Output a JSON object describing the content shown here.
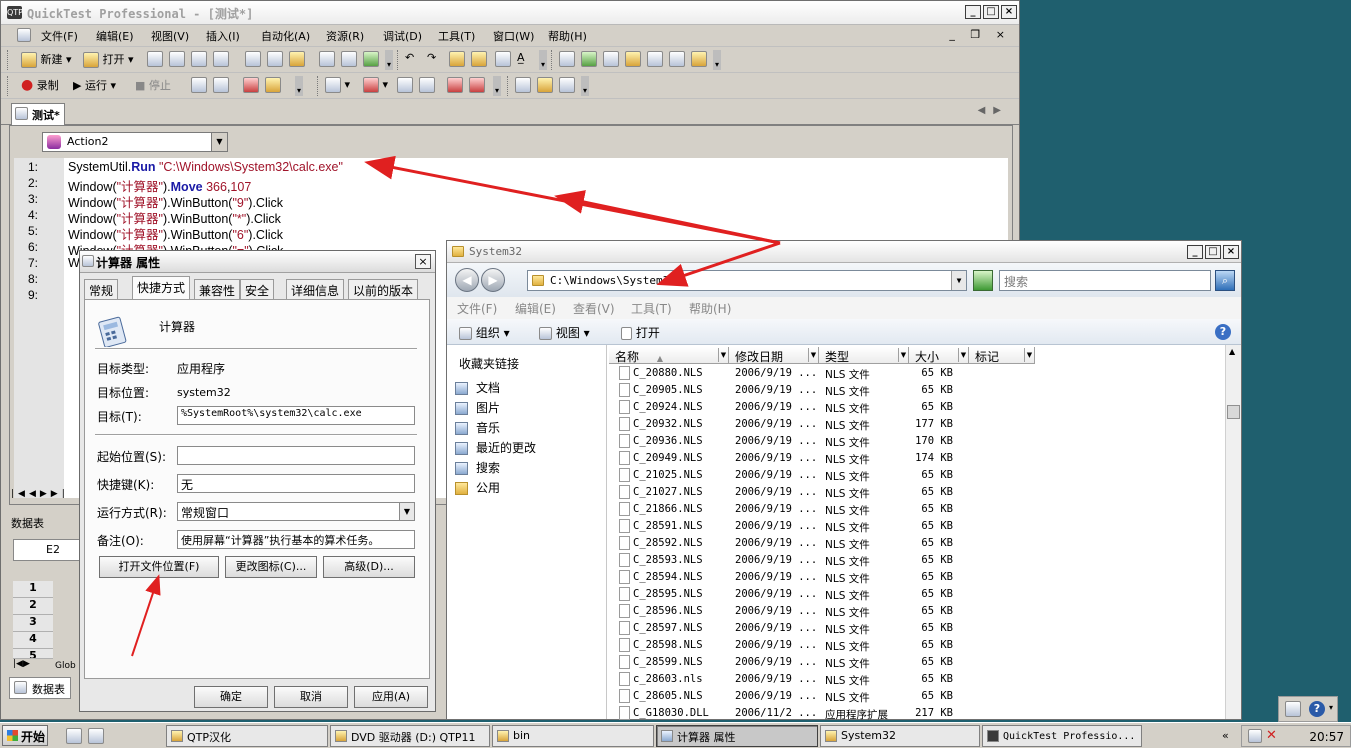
{
  "qtp": {
    "title": "QuickTest Professional - [测试*]",
    "app_icon": "QTP",
    "menu": [
      "文件(F)",
      "编辑(E)",
      "视图(V)",
      "插入(I)",
      "自动化(A)",
      "资源(R)",
      "调试(D)",
      "工具(T)",
      "窗口(W)",
      "帮助(H)"
    ],
    "toolbar1": {
      "new": "新建",
      "open": "打开"
    },
    "toolbar2": {
      "record": "录制",
      "run": "运行",
      "stop": "停止"
    },
    "tab": "测试*",
    "action": "Action2",
    "code_lines": [
      {
        "n": "1:",
        "parts": [
          [
            "t",
            "SystemUtil."
          ],
          [
            "kw",
            "Run"
          ],
          [
            "t",
            " "
          ],
          [
            "str",
            "\"C:\\Windows\\System32\\calc.exe\""
          ]
        ]
      },
      {
        "n": "2:",
        "parts": [
          [
            "t",
            "Window("
          ],
          [
            "str",
            "\"计算器\""
          ],
          [
            "t",
            ")."
          ],
          [
            "kw",
            "Move"
          ],
          [
            "t",
            " "
          ],
          [
            "num",
            "366"
          ],
          [
            "t",
            ","
          ],
          [
            "num",
            "107"
          ]
        ]
      },
      {
        "n": "3:",
        "parts": [
          [
            "t",
            "Window("
          ],
          [
            "str",
            "\"计算器\""
          ],
          [
            "t",
            ").WinButton("
          ],
          [
            "str",
            "\"9\""
          ],
          [
            "t",
            ").Click"
          ]
        ]
      },
      {
        "n": "4:",
        "parts": [
          [
            "t",
            "Window("
          ],
          [
            "str",
            "\"计算器\""
          ],
          [
            "t",
            ").WinButton("
          ],
          [
            "str",
            "\"*\""
          ],
          [
            "t",
            ").Click"
          ]
        ]
      },
      {
        "n": "5:",
        "parts": [
          [
            "t",
            "Window("
          ],
          [
            "str",
            "\"计算器\""
          ],
          [
            "t",
            ").WinButton("
          ],
          [
            "str",
            "\"6\""
          ],
          [
            "t",
            ").Click"
          ]
        ]
      },
      {
        "n": "6:",
        "parts": [
          [
            "t",
            "Window("
          ],
          [
            "str",
            "\"计算器\""
          ],
          [
            "t",
            ").WinButton("
          ],
          [
            "str",
            "\"=\""
          ],
          [
            "t",
            ").Click"
          ]
        ]
      },
      {
        "n": "7:",
        "parts": [
          [
            "t",
            "W"
          ]
        ]
      },
      {
        "n": "8:",
        "parts": []
      },
      {
        "n": "9:",
        "parts": []
      }
    ],
    "datatable": {
      "title": "数据表",
      "cell": "E2",
      "rows": [
        "1",
        "2",
        "3",
        "4",
        "5"
      ],
      "sheet_tab": "Glob",
      "tab_label": "数据表"
    }
  },
  "props": {
    "title": "计算器 属性",
    "tabs": [
      "常规",
      "快捷方式",
      "兼容性",
      "安全",
      "详细信息",
      "以前的版本"
    ],
    "name": "计算器",
    "target_type_label": "目标类型:",
    "target_type": "应用程序",
    "target_loc_label": "目标位置:",
    "target_loc": "system32",
    "target_label": "目标(T):",
    "target": "%SystemRoot%\\system32\\calc.exe",
    "start_label": "起始位置(S):",
    "start": "",
    "hotkey_label": "快捷键(K):",
    "hotkey": "无",
    "run_label": "运行方式(R):",
    "run": "常规窗口",
    "comment_label": "备注(O):",
    "comment": "使用屏幕“计算器”执行基本的算术任务。",
    "btn_open_loc": "打开文件位置(F)",
    "btn_change_icon": "更改图标(C)...",
    "btn_advanced": "高级(D)...",
    "btn_ok": "确定",
    "btn_cancel": "取消",
    "btn_apply": "应用(A)"
  },
  "explorer": {
    "title": "System32",
    "address": "C:\\Windows\\System32",
    "search_placeholder": "搜索",
    "menu": [
      "文件(F)",
      "编辑(E)",
      "查看(V)",
      "工具(T)",
      "帮助(H)"
    ],
    "cmd": {
      "organize": "组织",
      "views": "视图",
      "open": "打开"
    },
    "nav_header": "收藏夹链接",
    "nav_items": [
      "文档",
      "图片",
      "音乐",
      "最近的更改",
      "搜索",
      "公用"
    ],
    "columns": [
      "名称",
      "修改日期",
      "类型",
      "大小",
      "标记"
    ],
    "files": [
      [
        "C_20880.NLS",
        "2006/9/19 ...",
        "NLS 文件",
        "65 KB"
      ],
      [
        "C_20905.NLS",
        "2006/9/19 ...",
        "NLS 文件",
        "65 KB"
      ],
      [
        "C_20924.NLS",
        "2006/9/19 ...",
        "NLS 文件",
        "65 KB"
      ],
      [
        "C_20932.NLS",
        "2006/9/19 ...",
        "NLS 文件",
        "177 KB"
      ],
      [
        "C_20936.NLS",
        "2006/9/19 ...",
        "NLS 文件",
        "170 KB"
      ],
      [
        "C_20949.NLS",
        "2006/9/19 ...",
        "NLS 文件",
        "174 KB"
      ],
      [
        "C_21025.NLS",
        "2006/9/19 ...",
        "NLS 文件",
        "65 KB"
      ],
      [
        "C_21027.NLS",
        "2006/9/19 ...",
        "NLS 文件",
        "65 KB"
      ],
      [
        "C_21866.NLS",
        "2006/9/19 ...",
        "NLS 文件",
        "65 KB"
      ],
      [
        "C_28591.NLS",
        "2006/9/19 ...",
        "NLS 文件",
        "65 KB"
      ],
      [
        "C_28592.NLS",
        "2006/9/19 ...",
        "NLS 文件",
        "65 KB"
      ],
      [
        "C_28593.NLS",
        "2006/9/19 ...",
        "NLS 文件",
        "65 KB"
      ],
      [
        "C_28594.NLS",
        "2006/9/19 ...",
        "NLS 文件",
        "65 KB"
      ],
      [
        "C_28595.NLS",
        "2006/9/19 ...",
        "NLS 文件",
        "65 KB"
      ],
      [
        "C_28596.NLS",
        "2006/9/19 ...",
        "NLS 文件",
        "65 KB"
      ],
      [
        "C_28597.NLS",
        "2006/9/19 ...",
        "NLS 文件",
        "65 KB"
      ],
      [
        "C_28598.NLS",
        "2006/9/19 ...",
        "NLS 文件",
        "65 KB"
      ],
      [
        "C_28599.NLS",
        "2006/9/19 ...",
        "NLS 文件",
        "65 KB"
      ],
      [
        "c_28603.nls",
        "2006/9/19 ...",
        "NLS 文件",
        "65 KB"
      ],
      [
        "C_28605.NLS",
        "2006/9/19 ...",
        "NLS 文件",
        "65 KB"
      ],
      [
        "C_G18030.DLL",
        "2006/11/2 ...",
        "应用程序扩展",
        "217 KB"
      ]
    ]
  },
  "taskbar": {
    "start": "开始",
    "tasks": [
      "QTP汉化",
      "DVD 驱动器 (D:) QTP11",
      "bin",
      "计算器 属性",
      "System32",
      "QuickTest Professio..."
    ],
    "clock": "20:57"
  },
  "colors": {
    "annotation_arrow": "#e02020",
    "desktop": "#1f5f6e"
  }
}
